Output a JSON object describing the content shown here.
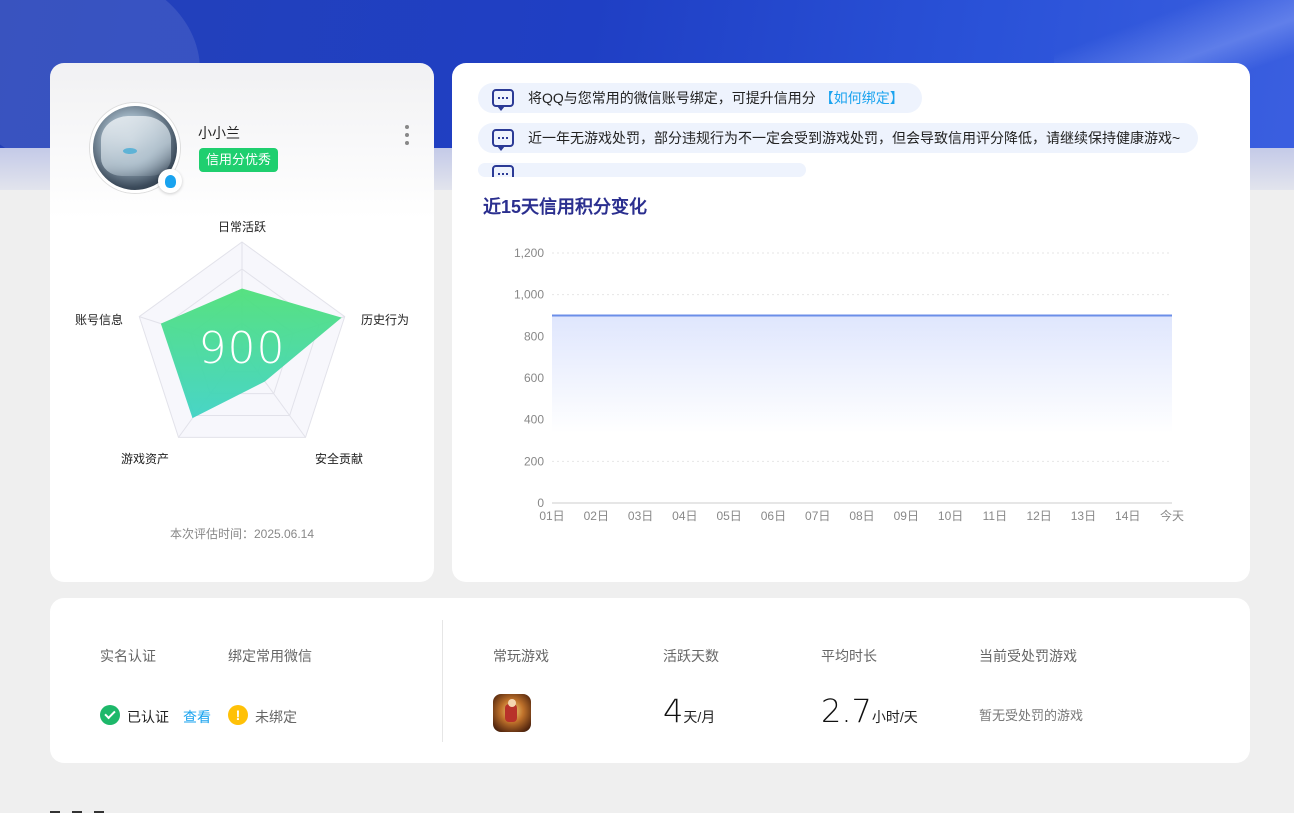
{
  "profile": {
    "username": "小小兰",
    "credit_badge": "信用分优秀",
    "score": "900",
    "eval_time": "本次评估时间：2025.06.14",
    "radar_labels": {
      "daily": "日常活跃",
      "history": "历史行为",
      "security": "安全贡献",
      "assets": "游戏资产",
      "account": "账号信息"
    },
    "radar_values": {
      "daily": 0.57,
      "history": 0.97,
      "security": 0.36,
      "assets": 0.78,
      "account": 0.79
    }
  },
  "notices": [
    {
      "text": "将QQ与您常用的微信账号绑定，可提升信用分",
      "link": "【如何绑定】"
    },
    {
      "text": "近一年无游戏处罚，部分违规行为不一定会受到游戏处罚，但会导致信用评分降低，请继续保持健康游戏~",
      "link": ""
    }
  ],
  "chart_data": {
    "type": "area",
    "title": "近15天信用积分变化",
    "categories": [
      "01日",
      "02日",
      "03日",
      "04日",
      "05日",
      "06日",
      "07日",
      "08日",
      "09日",
      "10日",
      "11日",
      "12日",
      "13日",
      "14日",
      "今天"
    ],
    "series": [
      {
        "values": [
          900,
          900,
          900,
          900,
          900,
          900,
          900,
          900,
          900,
          900,
          900,
          900,
          900,
          900,
          900
        ]
      }
    ],
    "y_ticks": [
      "0",
      "200",
      "400",
      "600",
      "800",
      "1,000",
      "1,200"
    ],
    "ylim": [
      0,
      1200
    ],
    "color": "#6b8ee8",
    "grid": true
  },
  "stats": {
    "realname_label": "实名认证",
    "wechat_label": "绑定常用微信",
    "realname_status": "已认证",
    "view_link": "查看",
    "wechat_status": "未绑定",
    "common_game_label": "常玩游戏",
    "active_days_label": "活跃天数",
    "active_days_value": "4",
    "active_days_unit": "天/月",
    "avg_time_label": "平均时长",
    "avg_time_value": "2.7",
    "avg_time_unit": "小时/天",
    "penalty_label": "当前受处罚游戏",
    "penalty_status": "暂无受处罚的游戏"
  }
}
